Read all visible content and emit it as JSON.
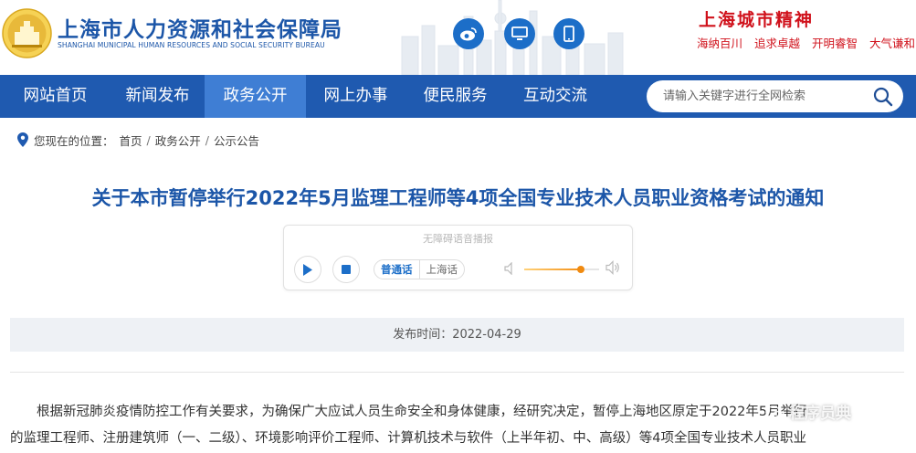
{
  "header": {
    "site_title": "上海市人力资源和社会保障局",
    "site_subtitle": "SHANGHAI MUNICIPAL HUMAN RESOURCES AND SOCIAL SECURITY BUREAU",
    "social_icons": [
      "weibo-icon",
      "desktop-icon",
      "mobile-icon"
    ],
    "spirit_title": "上海城市精神",
    "spirit_items": [
      "海纳百川",
      "追求卓越",
      "开明睿智",
      "大气谦和"
    ]
  },
  "nav": {
    "items": [
      {
        "label": "网站首页"
      },
      {
        "label": "新闻发布"
      },
      {
        "label": "政务公开"
      },
      {
        "label": "网上办事"
      },
      {
        "label": "便民服务"
      },
      {
        "label": "互动交流"
      }
    ],
    "active_index": 2,
    "search_placeholder": "请输入关键字进行全网检索"
  },
  "breadcrumb": {
    "prefix": "您现在的位置：",
    "items": [
      "首页",
      "政务公开",
      "公示公告"
    ]
  },
  "article": {
    "title": "关于本市暂停举行2022年5月监理工程师等4项全国专业技术人员职业资格考试的通知",
    "player": {
      "title": "无障碍语音播报",
      "languages": [
        "普通话",
        "上海话"
      ],
      "selected_language": "普通话",
      "volume": 0.75
    },
    "publish_label": "发布时间：",
    "publish_date": "2022-04-29",
    "paragraph_line1": "根据新冠肺炎疫情防控工作有关要求，为确保广大应试人员生命安全和身体健康，经研究决定，暂停上海地区原定于2022年5月举行",
    "paragraph_line2": "的监理工程师、注册建筑师（一、二级）、环境影响评价工程师、计算机技术与软件（上半年初、中、高级）等4项全国专业技术人员职业"
  },
  "watermark": "程序员典",
  "colors": {
    "primary": "#1f5ab0",
    "nav_active": "#3f7ed4",
    "title_blue": "#1c56a8",
    "spirit_red": "#d0111b",
    "slider_orange": "#f08a10"
  }
}
